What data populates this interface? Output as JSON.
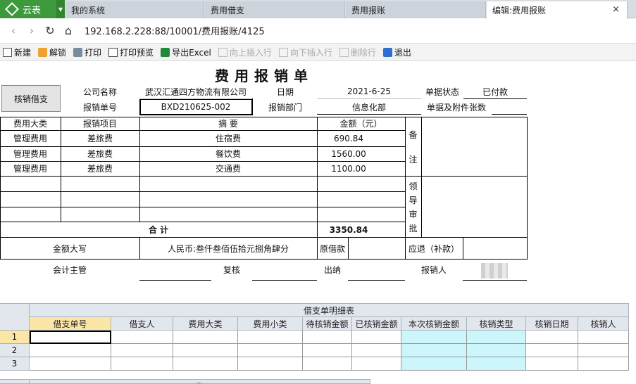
{
  "tabs": {
    "brand": "云表",
    "items": [
      {
        "label": "我的系统"
      },
      {
        "label": "费用借支"
      },
      {
        "label": "费用报账"
      },
      {
        "label": "编辑:费用报账"
      }
    ],
    "close": "×"
  },
  "address": {
    "url": "192.168.2.228:88/10001/费用报账/4125"
  },
  "toolbar": {
    "new": "新建",
    "unlock": "解锁",
    "print": "打印",
    "print_preview": "打印预览",
    "export_excel": "导出Excel",
    "insert_above": "向上插入行",
    "insert_below": "向下插入行",
    "delete_row": "删除行",
    "exit": "退出"
  },
  "form": {
    "title": "费用报销单",
    "settle_button": "核销借支",
    "company_label": "公司名称",
    "company_value": "武汉汇通四方物流有限公司",
    "date_label": "日期",
    "date_value": "2021-6-25",
    "status_label": "单据状态",
    "status_value": "已付款",
    "number_label": "报销单号",
    "number_value": "BXD210625-002",
    "dept_label": "报销部门",
    "dept_value": "信息化部",
    "attach_label": "单据及附件张数",
    "attach_value": "",
    "columns": {
      "category": "费用大类",
      "item": "报销项目",
      "summary": "摘          要",
      "amount": "金额（元）"
    },
    "rows": [
      {
        "category": "管理费用",
        "item": "差旅费",
        "summary": "住宿费",
        "amount": "690.84"
      },
      {
        "category": "管理费用",
        "item": "差旅费",
        "summary": "餐饮费",
        "amount": "1560.00"
      },
      {
        "category": "管理费用",
        "item": "差旅费",
        "summary": "交通费",
        "amount": "1100.00"
      }
    ],
    "remarks_chars": [
      "备",
      "注"
    ],
    "approve_chars": [
      "领",
      "导",
      "审",
      "批"
    ],
    "total_label": "合          计",
    "total_value": "3350.84",
    "uppercase_label": "金额大写",
    "uppercase_value": "人民币:叁仟叁佰伍拾元捌角肆分",
    "original_loan_label": "原借款",
    "original_loan_value": "",
    "refund_label": "应退（补款）",
    "refund_value": "",
    "supervisor_label": "会计主管",
    "review_label": "复核",
    "cashier_label": "出纳",
    "claimant_label": "报销人"
  },
  "detail": {
    "title": "借支单明细表",
    "columns": [
      "借支单号",
      "借支人",
      "费用大类",
      "费用小类",
      "待核销金额",
      "已核销金额",
      "本次核销金额",
      "核销类型",
      "核销日期",
      "核销人"
    ],
    "row_numbers": [
      "1",
      "2",
      "3"
    ],
    "bottom_label": "…"
  }
}
